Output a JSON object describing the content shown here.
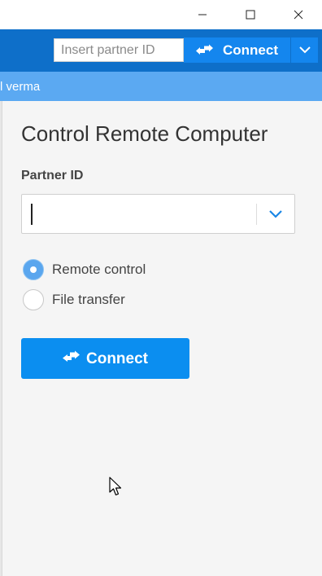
{
  "window": {
    "minimize_icon": "minimize-icon",
    "maximize_icon": "maximize-icon",
    "close_icon": "close-icon"
  },
  "toolbar": {
    "partner_id_placeholder": "Insert partner ID",
    "connect_label": "Connect",
    "connect_icon": "swap-arrows-icon",
    "dropdown_icon": "chevron-down-icon",
    "background_color": "#0e6fc9",
    "button_color": "#1486ee"
  },
  "account": {
    "name": "l verma",
    "background_color": "#5ba9f2"
  },
  "main": {
    "title": "Control Remote Computer",
    "partner_id_label": "Partner ID",
    "partner_id_value": "",
    "options": [
      {
        "label": "Remote control",
        "selected": true
      },
      {
        "label": "File transfer",
        "selected": false
      }
    ],
    "connect_label": "Connect",
    "connect_color": "#0b8ef0"
  }
}
